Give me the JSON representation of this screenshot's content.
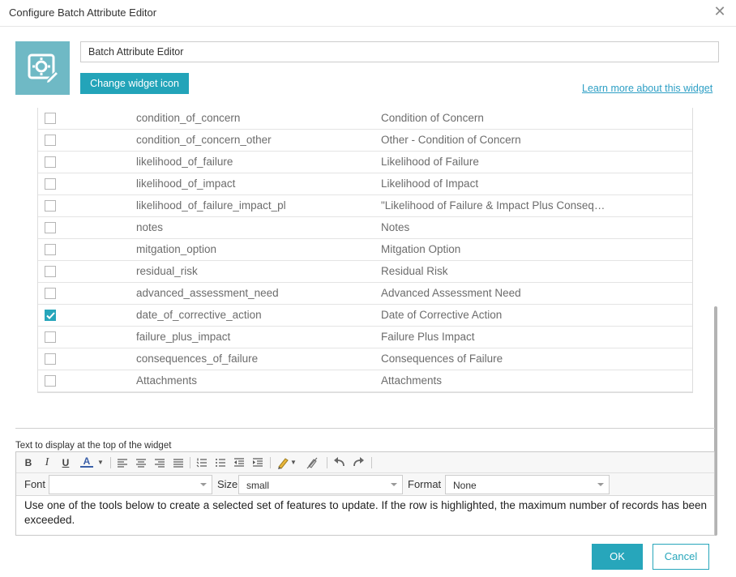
{
  "dialog": {
    "title": "Configure Batch Attribute Editor"
  },
  "widget": {
    "name": "Batch Attribute Editor",
    "change_icon_label": "Change widget icon",
    "learn_more_label": "Learn more about this widget",
    "icon": "settings-edit-icon"
  },
  "fields": [
    {
      "name": "condition_of_concern",
      "alias": "Condition of Concern",
      "checked": false
    },
    {
      "name": "condition_of_concern_other",
      "alias": "Other - Condition of Concern",
      "checked": false
    },
    {
      "name": "likelihood_of_failure",
      "alias": "Likelihood of Failure",
      "checked": false
    },
    {
      "name": "likelihood_of_impact",
      "alias": "Likelihood of Impact",
      "checked": false
    },
    {
      "name": "likelihood_of_failure_impact_pl",
      "alias": "\"Likelihood of Failure & Impact Plus Conseq…",
      "checked": false
    },
    {
      "name": "notes",
      "alias": "Notes",
      "checked": false
    },
    {
      "name": "mitgation_option",
      "alias": "Mitgation Option",
      "checked": false
    },
    {
      "name": "residual_risk",
      "alias": "Residual Risk",
      "checked": false
    },
    {
      "name": "advanced_assessment_need",
      "alias": "Advanced Assessment Need",
      "checked": false
    },
    {
      "name": "date_of_corrective_action",
      "alias": "Date of Corrective Action",
      "checked": true
    },
    {
      "name": "failure_plus_impact",
      "alias": "Failure Plus Impact",
      "checked": false
    },
    {
      "name": "consequences_of_failure",
      "alias": "Consequences of Failure",
      "checked": false
    },
    {
      "name": "Attachments",
      "alias": "Attachments",
      "checked": false
    }
  ],
  "editor": {
    "label": "Text to display at the top of the widget",
    "toolbar": {
      "bold": "B",
      "italic": "I",
      "underline": "U",
      "font_color": "A"
    },
    "font_label": "Font",
    "font_value": "",
    "size_label": "Size",
    "size_value": "small",
    "format_label": "Format",
    "format_value": "None",
    "content": "Use one of the tools below to create a selected set of features to update. If the row is highlighted, the maximum number of records has been exceeded."
  },
  "buttons": {
    "ok": "OK",
    "cancel": "Cancel"
  },
  "colors": {
    "accent": "#27a6bb",
    "icon_bg": "#6fb9c5",
    "link": "#2d9fc5"
  }
}
